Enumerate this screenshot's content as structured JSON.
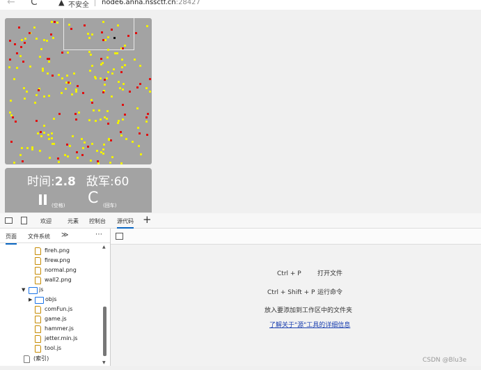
{
  "browser": {
    "insecure_label": "不安全",
    "url_host": "node6.anna.nssctf.cn",
    "url_port": ":28427",
    "back_icon": "←",
    "reload_icon": "C",
    "warning_icon": "▲"
  },
  "game": {
    "colors": {
      "background": "#a3a3a3",
      "enemy": "#e01010",
      "yellow": "#f0f000"
    },
    "hud": {
      "time_label": "时间:",
      "time_value": "2.8",
      "enemy_label": "敌军:",
      "enemy_value": "60",
      "pause_hint": "(空格)",
      "restart_hint": "(回车)",
      "restart_icon": "C"
    }
  },
  "devtools": {
    "tabs": [
      "欢迎",
      "元素",
      "控制台",
      "源代码"
    ],
    "active_tab": "源代码",
    "add_tab_icon": "+",
    "subtabs": {
      "page": "页面",
      "filesystem": "文件系统",
      "more": "≫",
      "menu": "⋯"
    },
    "tree": {
      "files_top": [
        "fireh.png",
        "firew.png",
        "normal.png",
        "wall2.png"
      ],
      "js_folder": "js",
      "objs_folder": "objs",
      "js_files": [
        "comFun.js",
        "game.js",
        "hammer.js",
        "jetter.min.js",
        "tool.js"
      ],
      "index": "(索引)"
    },
    "shortcuts": [
      {
        "keys": "Ctrl + P",
        "action": "打开文件"
      },
      {
        "keys": "Ctrl + Shift + P",
        "action": "运行命令"
      }
    ],
    "drop_hint": "放入要添加到工作区中的文件夹",
    "learn_link": "了解关于\"源\"工具的详细信息"
  },
  "watermark": "CSDN @Blu3e"
}
